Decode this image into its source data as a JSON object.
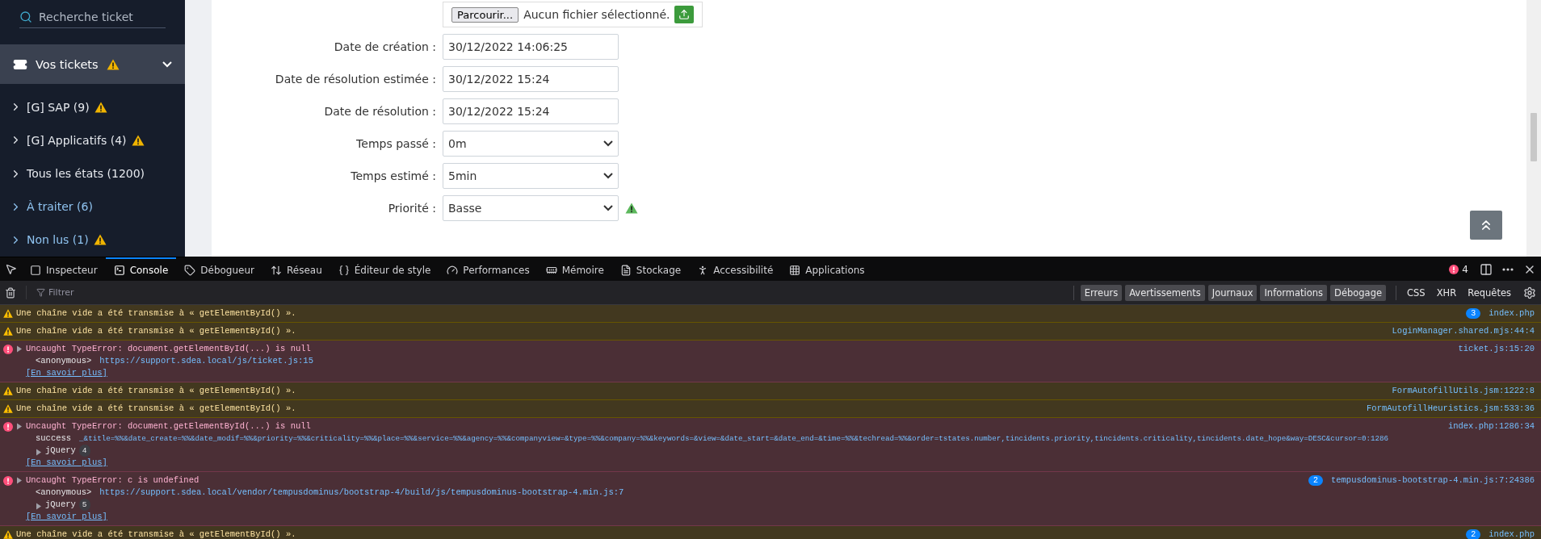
{
  "sidebar": {
    "search": {
      "placeholder": "Recherche ticket"
    },
    "section": {
      "label": "Vos tickets",
      "warning": true,
      "expanded": true
    },
    "items": [
      {
        "label": "[G] SAP (9)",
        "warning": true,
        "highlighted": false
      },
      {
        "label": "[G] Applicatifs (4)",
        "warning": true,
        "highlighted": false
      },
      {
        "label": "Tous les états (1200)",
        "warning": false,
        "highlighted": false
      },
      {
        "label": "À traiter (6)",
        "warning": false,
        "highlighted": true
      },
      {
        "label": "Non lus (1)",
        "warning": true,
        "highlighted": true
      }
    ]
  },
  "form": {
    "file": {
      "button": "Parcourir...",
      "status": "Aucun fichier sélectionné."
    },
    "fields": [
      {
        "label": "Date de création :",
        "value": "30/12/2022 14:06:25",
        "kind": "input",
        "warning": false
      },
      {
        "label": "Date de résolution estimée :",
        "value": "30/12/2022 15:24",
        "kind": "input",
        "warning": false
      },
      {
        "label": "Date de résolution :",
        "value": "30/12/2022 15:24",
        "kind": "input",
        "warning": false
      },
      {
        "label": "Temps passé :",
        "value": "0m",
        "kind": "select",
        "warning": false
      },
      {
        "label": "Temps estimé :",
        "value": "5min",
        "kind": "select",
        "warning": false
      },
      {
        "label": "Priorité :",
        "value": "Basse",
        "kind": "select",
        "warning": true
      }
    ]
  },
  "devtools": {
    "tabs": [
      {
        "label": "Inspecteur",
        "selected": false
      },
      {
        "label": "Console",
        "selected": true
      },
      {
        "label": "Débogueur",
        "selected": false
      },
      {
        "label": "Réseau",
        "selected": false
      },
      {
        "label": "Éditeur de style",
        "selected": false
      },
      {
        "label": "Performances",
        "selected": false
      },
      {
        "label": "Mémoire",
        "selected": false
      },
      {
        "label": "Stockage",
        "selected": false
      },
      {
        "label": "Accessibilité",
        "selected": false
      },
      {
        "label": "Applications",
        "selected": false
      }
    ],
    "error_count": "4",
    "filter_placeholder": "Filtrer",
    "filters": [
      {
        "label": "Erreurs",
        "selected": true
      },
      {
        "label": "Avertissements",
        "selected": true
      },
      {
        "label": "Journaux",
        "selected": true
      },
      {
        "label": "Informations",
        "selected": true
      },
      {
        "label": "Débogage",
        "selected": true
      }
    ],
    "request_filters": [
      {
        "label": "CSS",
        "selected": false
      },
      {
        "label": "XHR",
        "selected": false
      },
      {
        "label": "Requêtes",
        "selected": false
      }
    ],
    "messages": [
      {
        "kind": "warning",
        "text": "Une chaîne vide a été transmise à « getElementById() ».",
        "source": "index.php",
        "repeat": "3"
      },
      {
        "kind": "warning",
        "text": "Une chaîne vide a été transmise à « getElementById() ».",
        "source": "LoginManager.shared.mjs:44:4"
      },
      {
        "kind": "error",
        "text": "Uncaught TypeError: document.getElementById(...) is null",
        "source": "ticket.js:15:20",
        "trace": [
          {
            "kind": "frame",
            "fn": "<anonymous>",
            "url": "https://support.sdea.local/js/ticket.js:15"
          }
        ],
        "learn_more": "[En savoir plus]"
      },
      {
        "kind": "warning",
        "text": "Une chaîne vide a été transmise à « getElementById() ».",
        "source": "FormAutofillUtils.jsm:1222:8"
      },
      {
        "kind": "warning",
        "text": "Une chaîne vide a été transmise à « getElementById() ».",
        "source": "FormAutofillHeuristics.jsm:533:36"
      },
      {
        "kind": "error",
        "text": "Uncaught TypeError: document.getElementById(...) is null",
        "source": "index.php:1286:34",
        "trace": [
          {
            "kind": "frame",
            "fn": "success",
            "url": "_&title=%%&date_create=%%&date_modif=%%&priority=%%&criticality=%%&place=%%&service=%%&agency=%%&companyview=&type=%%&company=%%&keywords=&view=&date_start=&date_end=&time=%%&techread=%%&order=tstates.number,tincidents.priority,tincidents.criticality,tincidents.date_hope&way=DESC&cursor=0:1286"
          },
          {
            "kind": "group",
            "fn": "jQuery",
            "count": "4"
          }
        ],
        "learn_more": "[En savoir plus]"
      },
      {
        "kind": "error",
        "text": "Uncaught TypeError: c is undefined",
        "source": "tempusdominus-bootstrap-4.min.js:7:24386",
        "repeat": "2",
        "trace": [
          {
            "kind": "frame",
            "fn": "<anonymous>",
            "url": "https://support.sdea.local/vendor/tempusdominus/bootstrap-4/build/js/tempusdominus-bootstrap-4.min.js:7"
          },
          {
            "kind": "group",
            "fn": "jQuery",
            "count": "5"
          }
        ],
        "learn_more": "[En savoir plus]"
      },
      {
        "kind": "warning",
        "text": "Une chaîne vide a été transmise à « getElementById() ».",
        "source": "index.php",
        "repeat": "2"
      }
    ]
  }
}
